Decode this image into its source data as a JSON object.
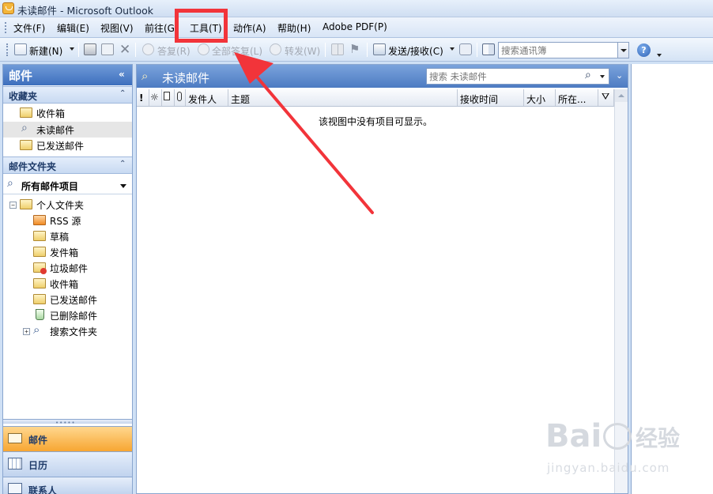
{
  "window": {
    "title": "未读邮件 - Microsoft Outlook"
  },
  "menu": {
    "items": [
      "文件(F)",
      "编辑(E)",
      "视图(V)",
      "前往(G)",
      "工具(T)",
      "动作(A)",
      "帮助(H)",
      "Adobe PDF(P)"
    ]
  },
  "toolbar": {
    "new_label": "新建(N)",
    "reply_label": "答复(R)",
    "reply_all_label": "全部答复(L)",
    "forward_label": "转发(W)",
    "send_receive_label": "发送/接收(C)",
    "search_contacts_placeholder": "搜索通讯簿"
  },
  "navpane": {
    "title": "邮件",
    "favorites": {
      "title": "收藏夹",
      "items": [
        "收件箱",
        "未读邮件",
        "已发送邮件"
      ],
      "selected": "未读邮件"
    },
    "mail_folders": {
      "title": "邮件文件夹",
      "dropdown_label": "所有邮件项目",
      "root": "个人文件夹",
      "folders": [
        "RSS 源",
        "草稿",
        "发件箱",
        "垃圾邮件",
        "收件箱",
        "已发送邮件",
        "已删除邮件",
        "搜索文件夹"
      ]
    },
    "nav_buttons": [
      "邮件",
      "日历",
      "联系人"
    ]
  },
  "listpane": {
    "title": "未读邮件",
    "search_placeholder": "搜索 未读邮件",
    "columns": [
      "!",
      "发件人",
      "主题",
      "接收时间",
      "大小",
      "所在..."
    ],
    "empty_message": "该视图中没有项目可显示。"
  },
  "watermark": {
    "brand": "Bai",
    "brand_cn": "经验",
    "url": "jingyan.baidu.com"
  },
  "colors": {
    "annotation": "#f2343a",
    "nav_active": "#f8a93a",
    "header_blue": "#4d7bc2"
  }
}
